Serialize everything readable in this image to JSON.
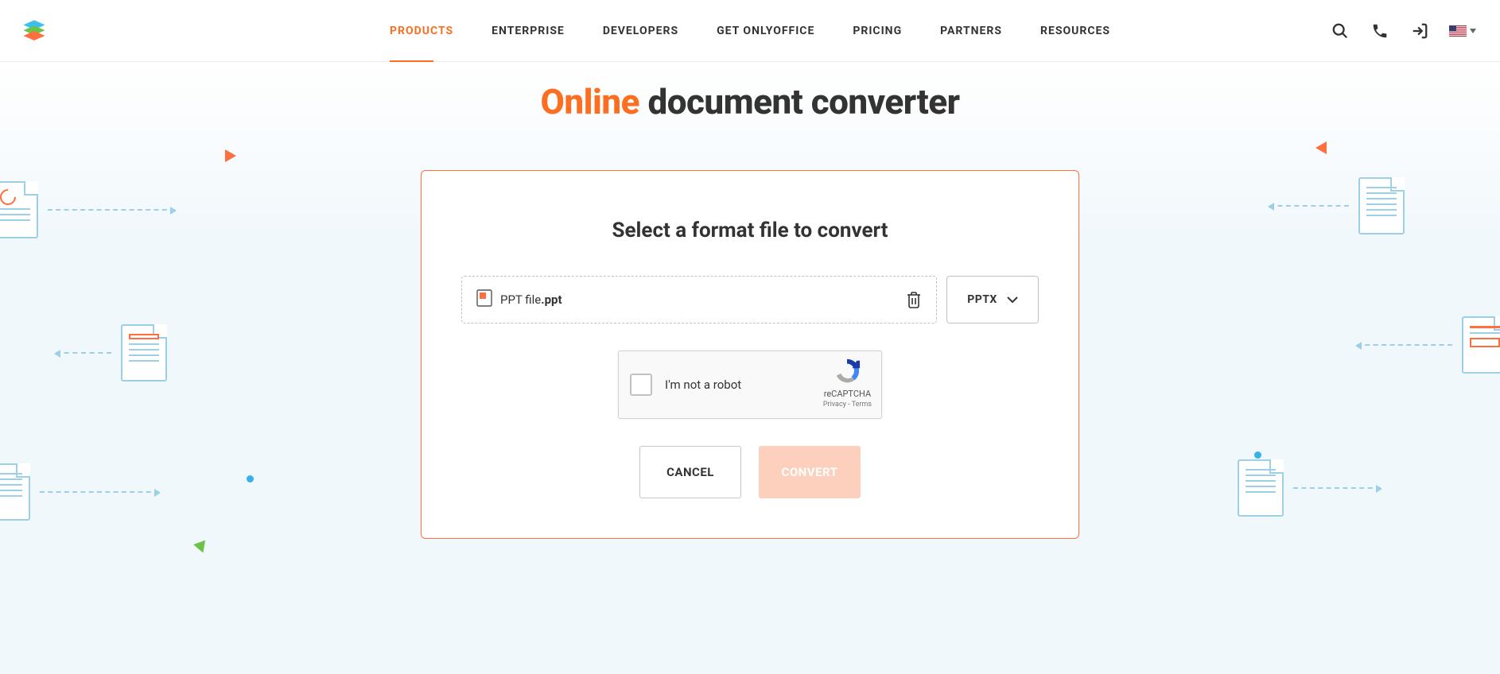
{
  "nav": {
    "items": [
      "PRODUCTS",
      "ENTERPRISE",
      "DEVELOPERS",
      "GET ONLYOFFICE",
      "PRICING",
      "PARTNERS",
      "RESOURCES"
    ],
    "active_index": 0
  },
  "title": {
    "accent": "Online",
    "rest": " document converter"
  },
  "card": {
    "heading": "Select a format file to convert",
    "file": {
      "name": "PPT file",
      "ext": ".ppt"
    },
    "format": "PPTX",
    "recaptcha": {
      "label": "I'm not a robot",
      "brand": "reCAPTCHA",
      "privacy": "Privacy",
      "terms": "Terms"
    },
    "cancel": "CANCEL",
    "convert": "CONVERT"
  }
}
